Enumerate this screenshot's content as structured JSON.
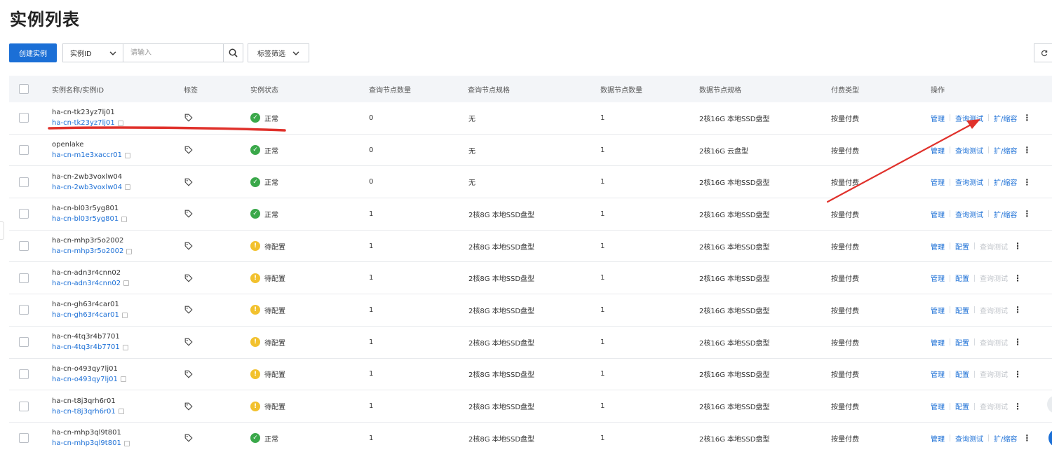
{
  "page_title": "实例列表",
  "toolbar": {
    "create_label": "创建实例",
    "search_field": "实例ID",
    "search_placeholder": "请输入",
    "tag_filter_label": "标签筛选"
  },
  "columns": [
    "实例名称/实例ID",
    "标签",
    "实例状态",
    "查询节点数量",
    "查询节点规格",
    "数据节点数量",
    "数据节点规格",
    "付费类型",
    "操作"
  ],
  "status_colors": {
    "正常": "#3aa84a",
    "待配置": "#f2c12e"
  },
  "accent_color": "#1b6fd6",
  "rows": [
    {
      "name": "ha-cn-tk23yz7lj01",
      "id": "ha-cn-tk23yz7lj01",
      "status": "正常",
      "q_count": "0",
      "q_spec": "无",
      "d_count": "1",
      "d_spec": "2核16G 本地SSD盘型",
      "pay": "按量付费",
      "ops": [
        "管理",
        "查询测试",
        "扩/缩容"
      ],
      "ops_disabled": [
        false,
        false,
        false
      ]
    },
    {
      "name": "openlake",
      "id": "ha-cn-m1e3xaccr01",
      "status": "正常",
      "q_count": "0",
      "q_spec": "无",
      "d_count": "1",
      "d_spec": "2核16G 云盘型",
      "pay": "按量付费",
      "ops": [
        "管理",
        "查询测试",
        "扩/缩容"
      ],
      "ops_disabled": [
        false,
        false,
        false
      ]
    },
    {
      "name": "ha-cn-2wb3voxlw04",
      "id": "ha-cn-2wb3voxlw04",
      "status": "正常",
      "q_count": "0",
      "q_spec": "无",
      "d_count": "1",
      "d_spec": "2核16G 本地SSD盘型",
      "pay": "按量付费",
      "ops": [
        "管理",
        "查询测试",
        "扩/缩容"
      ],
      "ops_disabled": [
        false,
        false,
        false
      ]
    },
    {
      "name": "ha-cn-bl03r5yg801",
      "id": "ha-cn-bl03r5yg801",
      "status": "正常",
      "q_count": "1",
      "q_spec": "2核8G 本地SSD盘型",
      "d_count": "1",
      "d_spec": "2核16G 本地SSD盘型",
      "pay": "按量付费",
      "ops": [
        "管理",
        "查询测试",
        "扩/缩容"
      ],
      "ops_disabled": [
        false,
        false,
        false
      ]
    },
    {
      "name": "ha-cn-mhp3r5o2002",
      "id": "ha-cn-mhp3r5o2002",
      "status": "待配置",
      "q_count": "1",
      "q_spec": "2核8G 本地SSD盘型",
      "d_count": "1",
      "d_spec": "2核16G 本地SSD盘型",
      "pay": "按量付费",
      "ops": [
        "管理",
        "配置",
        "查询测试"
      ],
      "ops_disabled": [
        false,
        false,
        true
      ]
    },
    {
      "name": "ha-cn-adn3r4cnn02",
      "id": "ha-cn-adn3r4cnn02",
      "status": "待配置",
      "q_count": "1",
      "q_spec": "2核8G 本地SSD盘型",
      "d_count": "1",
      "d_spec": "2核16G 本地SSD盘型",
      "pay": "按量付费",
      "ops": [
        "管理",
        "配置",
        "查询测试"
      ],
      "ops_disabled": [
        false,
        false,
        true
      ]
    },
    {
      "name": "ha-cn-gh63r4car01",
      "id": "ha-cn-gh63r4car01",
      "status": "待配置",
      "q_count": "1",
      "q_spec": "2核8G 本地SSD盘型",
      "d_count": "1",
      "d_spec": "2核16G 本地SSD盘型",
      "pay": "按量付费",
      "ops": [
        "管理",
        "配置",
        "查询测试"
      ],
      "ops_disabled": [
        false,
        false,
        true
      ]
    },
    {
      "name": "ha-cn-4tq3r4b7701",
      "id": "ha-cn-4tq3r4b7701",
      "status": "待配置",
      "q_count": "1",
      "q_spec": "2核8G 本地SSD盘型",
      "d_count": "1",
      "d_spec": "2核16G 本地SSD盘型",
      "pay": "按量付费",
      "ops": [
        "管理",
        "配置",
        "查询测试"
      ],
      "ops_disabled": [
        false,
        false,
        true
      ]
    },
    {
      "name": "ha-cn-o493qy7lj01",
      "id": "ha-cn-o493qy7lj01",
      "status": "待配置",
      "q_count": "1",
      "q_spec": "2核8G 本地SSD盘型",
      "d_count": "1",
      "d_spec": "2核16G 本地SSD盘型",
      "pay": "按量付费",
      "ops": [
        "管理",
        "配置",
        "查询测试"
      ],
      "ops_disabled": [
        false,
        false,
        true
      ]
    },
    {
      "name": "ha-cn-t8j3qrh6r01",
      "id": "ha-cn-t8j3qrh6r01",
      "status": "待配置",
      "q_count": "1",
      "q_spec": "2核8G 本地SSD盘型",
      "d_count": "1",
      "d_spec": "2核16G 本地SSD盘型",
      "pay": "按量付费",
      "ops": [
        "管理",
        "配置",
        "查询测试"
      ],
      "ops_disabled": [
        false,
        false,
        true
      ]
    },
    {
      "name": "ha-cn-mhp3ql9t801",
      "id": "ha-cn-mhp3ql9t801",
      "status": "正常",
      "q_count": "1",
      "q_spec": "2核8G 本地SSD盘型",
      "d_count": "1",
      "d_spec": "2核16G 本地SSD盘型",
      "pay": "按量付费",
      "ops": [
        "管理",
        "查询测试",
        "扩/缩容"
      ],
      "ops_disabled": [
        false,
        false,
        false
      ]
    }
  ]
}
